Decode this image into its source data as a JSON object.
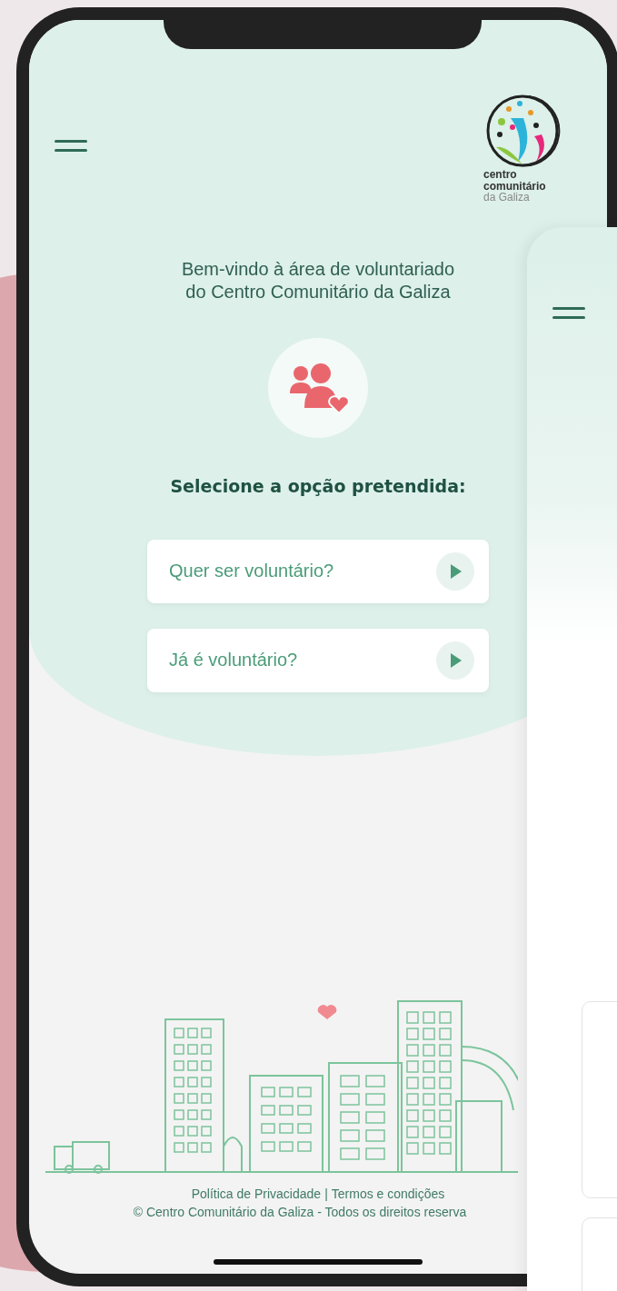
{
  "header": {
    "logo_lines": [
      "centro",
      "comunitário",
      "da Galiza"
    ]
  },
  "welcome_lines": [
    "Bem-vindo à área de voluntariado",
    "do Centro Comunitário da Galiza"
  ],
  "prompt": "Selecione a opção pretendida:",
  "options": [
    {
      "label": "Quer ser voluntário?"
    },
    {
      "label": "Já é voluntário?"
    }
  ],
  "footer": {
    "links": [
      "Política de Privacidade",
      "Termos e condições"
    ],
    "separator": "|",
    "copyright": "© Centro Comunitário da Galiza - Todos os direitos reserva"
  }
}
